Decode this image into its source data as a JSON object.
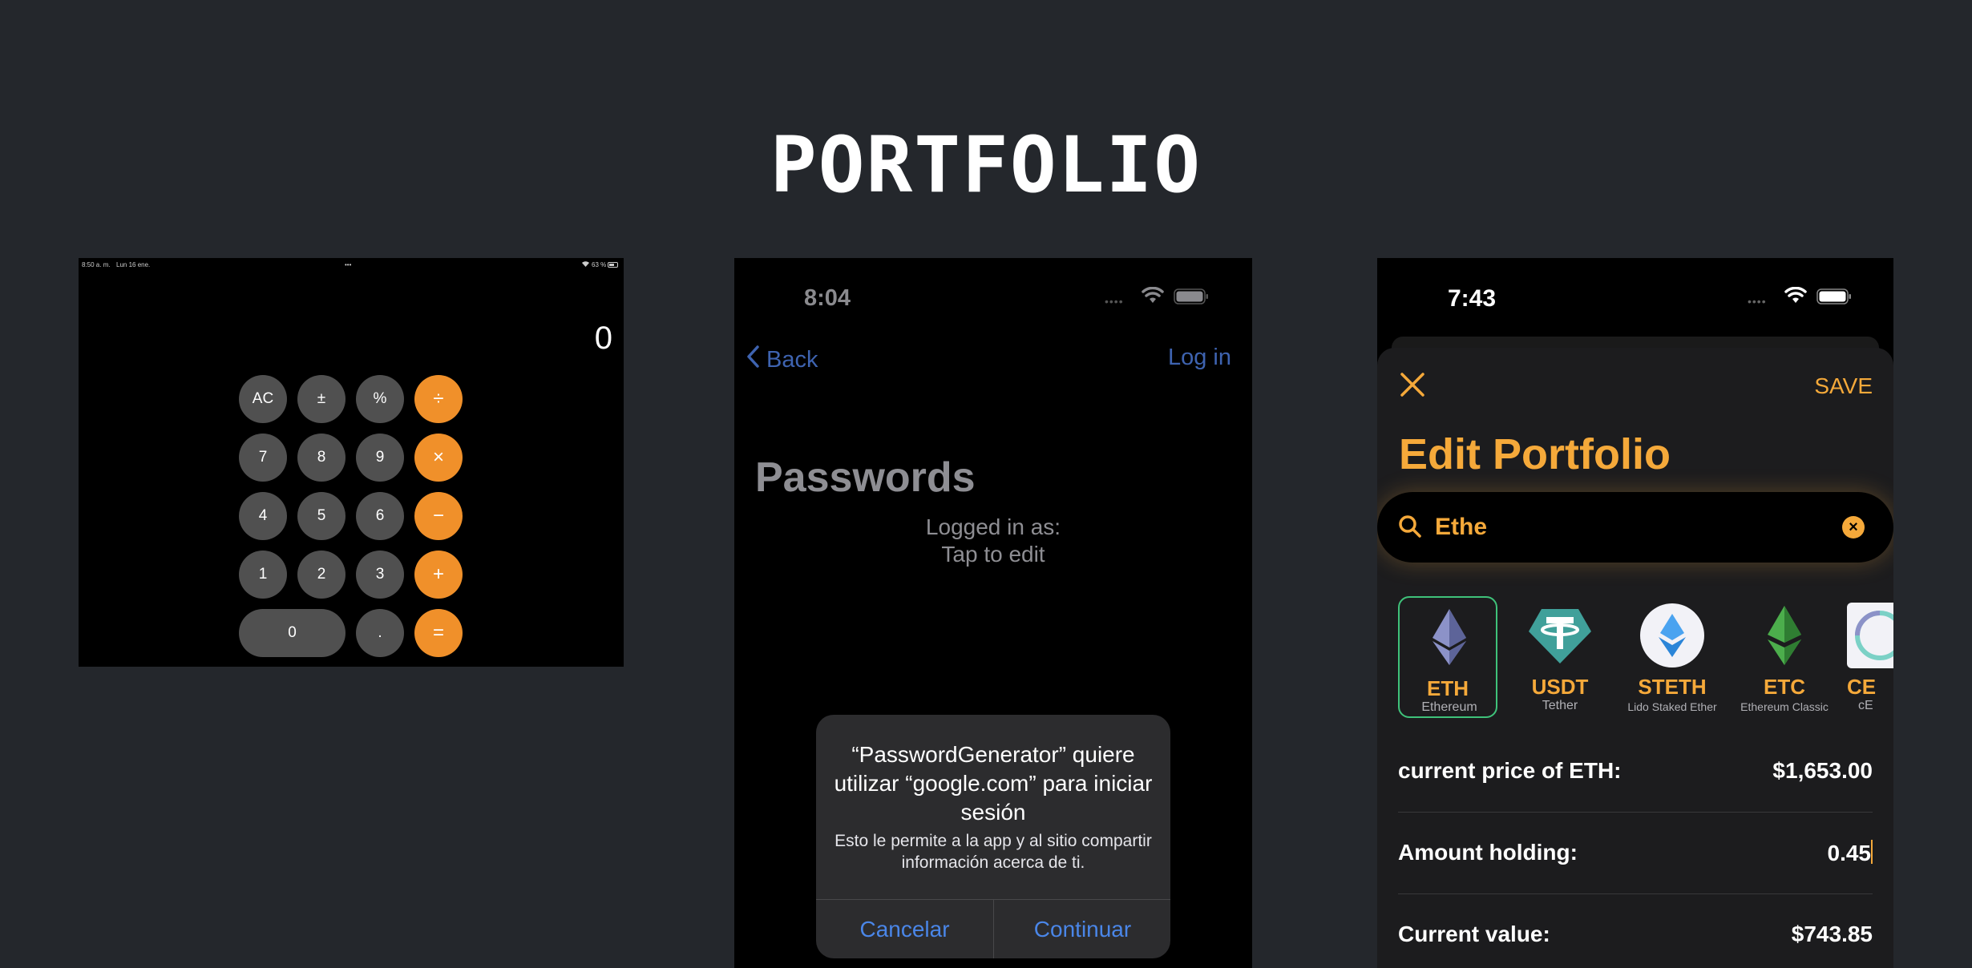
{
  "page": {
    "title": "PORTFOLIO"
  },
  "calculator": {
    "status_time": "8:50 a. m.",
    "status_date": "Lun 16 ene.",
    "status_dots": "•••",
    "status_battery": "63 %",
    "display": "0",
    "keys": [
      "AC",
      "±",
      "%",
      "÷",
      "7",
      "8",
      "9",
      "×",
      "4",
      "5",
      "6",
      "−",
      "1",
      "2",
      "3",
      "+",
      "0",
      ".",
      "="
    ],
    "operator_color": "#f0902a",
    "key_color": "#505050"
  },
  "passwords": {
    "status_time": "8:04",
    "back_label": "Back",
    "login_label": "Log in",
    "title": "Passwords",
    "logged_in_as": "Logged in as:",
    "tap_to_edit": "Tap to edit",
    "link_color": "#3e63b0",
    "alert": {
      "title": "“PasswordGenerator” quiere utilizar “google.com” para iniciar sesión",
      "message": "Esto le permite a la app y al sitio compartir información acerca de ti.",
      "cancel": "Cancelar",
      "continue": "Continuar"
    }
  },
  "edit_portfolio": {
    "status_time": "7:43",
    "close_icon": "close-icon",
    "save_label": "SAVE",
    "title": "Edit Portfolio",
    "search_value": "Ethe",
    "accent_color": "#f5a93a",
    "coins": [
      {
        "symbol": "ETH",
        "name": "Ethereum",
        "selected": true
      },
      {
        "symbol": "USDT",
        "name": "Tether",
        "selected": false
      },
      {
        "symbol": "STETH",
        "name": "Lido Staked Ether",
        "selected": false
      },
      {
        "symbol": "ETC",
        "name": "Ethereum Classic",
        "selected": false
      },
      {
        "symbol": "CE",
        "name": "cE",
        "selected": false
      }
    ],
    "rows": [
      {
        "label": "current price of ETH:",
        "value": "$1,653.00"
      },
      {
        "label": "Amount holding:",
        "value": "0.45"
      },
      {
        "label": "Current value:",
        "value": "$743.85"
      }
    ]
  }
}
